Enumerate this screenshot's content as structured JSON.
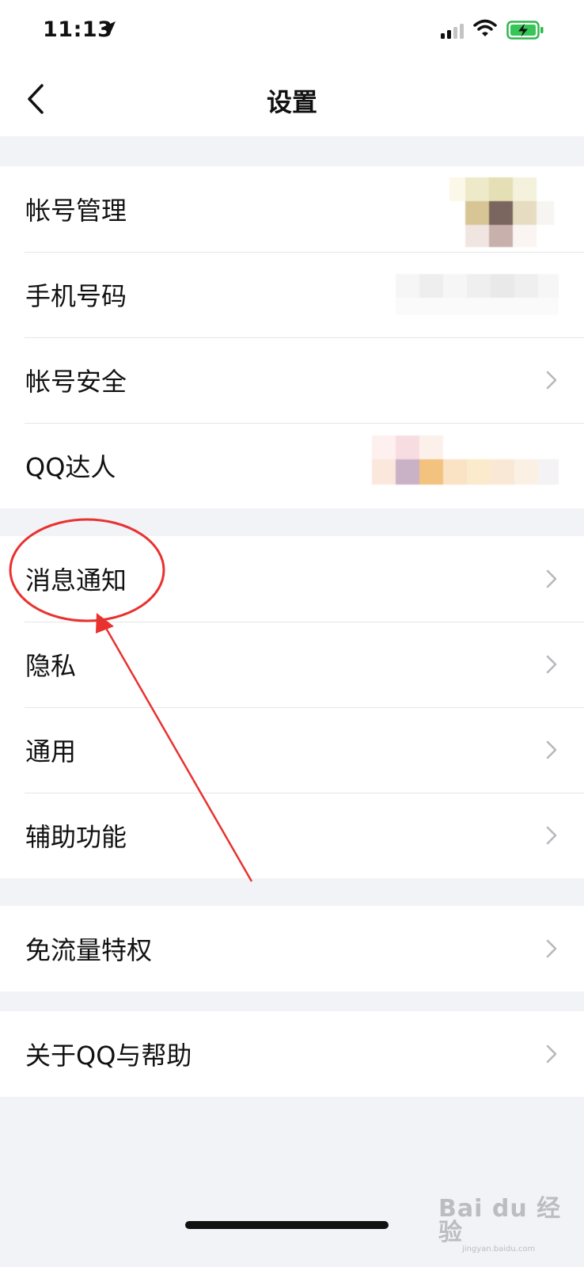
{
  "status_bar": {
    "time": "11:13"
  },
  "nav": {
    "title": "设置"
  },
  "groups": [
    {
      "items": [
        {
          "label": "帐号管理",
          "accessory": "blurred-avatar"
        },
        {
          "label": "手机号码",
          "accessory": "blurred-text"
        },
        {
          "label": "帐号安全",
          "accessory": "chevron-right-icon"
        },
        {
          "label": "QQ达人",
          "accessory": "blurred-badges"
        }
      ]
    },
    {
      "items": [
        {
          "label": "消息通知",
          "accessory": "chevron-right-icon",
          "annotated": true
        },
        {
          "label": "隐私",
          "accessory": "chevron-right-icon"
        },
        {
          "label": "通用",
          "accessory": "chevron-right-icon"
        },
        {
          "label": "辅助功能",
          "accessory": "chevron-right-icon"
        }
      ]
    },
    {
      "items": [
        {
          "label": "免流量特权",
          "accessory": "chevron-right-icon"
        }
      ]
    },
    {
      "items": [
        {
          "label": "关于QQ与帮助",
          "accessory": "chevron-right-icon"
        }
      ]
    }
  ],
  "watermark": {
    "main": "Bai du 经验",
    "sub": "jingyan.baidu.com"
  },
  "colors": {
    "background": "#f2f3f7",
    "annotation": "#e8322f",
    "chevron": "#b8b8bd"
  }
}
